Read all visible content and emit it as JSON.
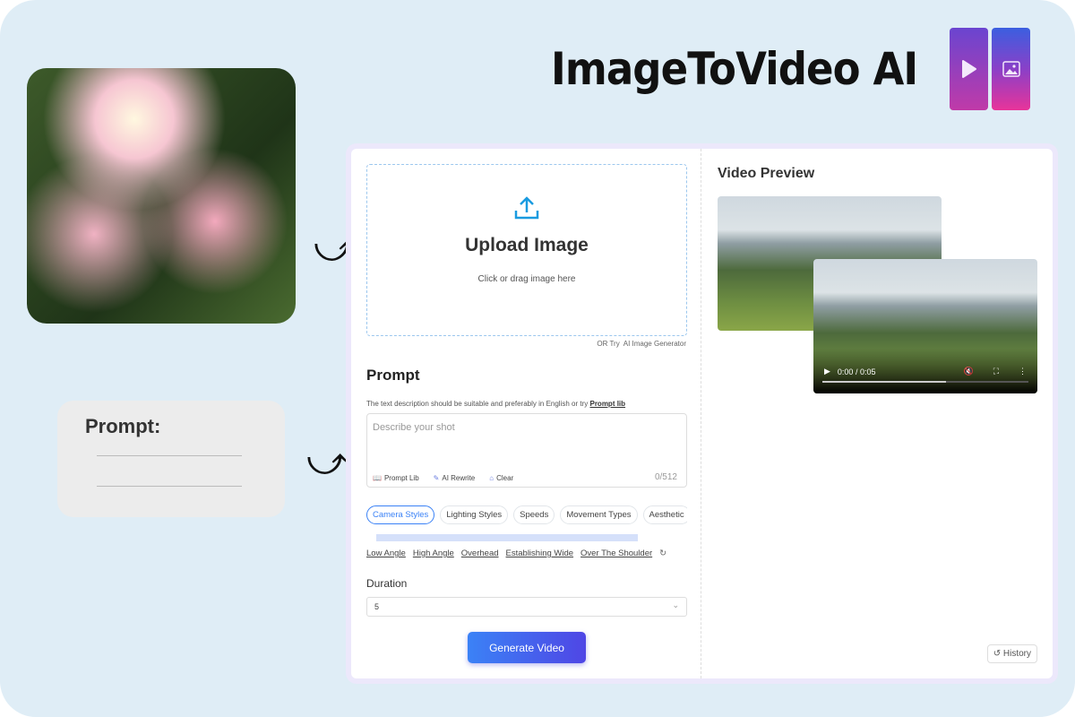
{
  "brand": {
    "title": "ImageToVideo AI"
  },
  "promo": {
    "prompt_card_label": "Prompt:"
  },
  "upload": {
    "title": "Upload Image",
    "subtitle": "Click or drag image here",
    "or_try": "OR Try",
    "ai_generator": "AI Image Generator"
  },
  "prompt": {
    "title": "Prompt",
    "description": "The text description should be suitable and preferably in English or try",
    "prompt_lib_link": "Prompt lib",
    "placeholder": "Describe your shot",
    "tools": [
      "Prompt Lib",
      "AI Rewrite",
      "Clear"
    ],
    "counter": "0/512"
  },
  "categories": [
    {
      "label": "Camera Styles",
      "active": true
    },
    {
      "label": "Lighting Styles"
    },
    {
      "label": "Speeds"
    },
    {
      "label": "Movement Types"
    },
    {
      "label": "Aesthetic"
    }
  ],
  "tags": [
    "Low Angle",
    "High Angle",
    "Overhead",
    "Establishing Wide",
    "Over The Shoulder"
  ],
  "duration": {
    "label": "Duration",
    "value": "5"
  },
  "generate_label": "Generate Video",
  "preview": {
    "title": "Video Preview",
    "time": "0:00 / 0:05",
    "progress": 0.6,
    "history_label": "History"
  },
  "colors": {
    "accent": "#3b82f6",
    "background": "#dfedf6"
  }
}
